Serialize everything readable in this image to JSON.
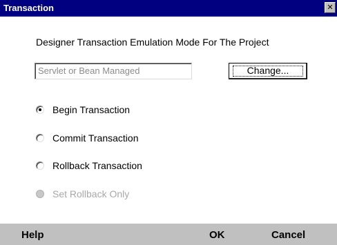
{
  "window": {
    "title": "Transaction",
    "close_glyph": "✕"
  },
  "heading": "Designer Transaction Emulation Mode For The Project",
  "mode_field": {
    "value": "Servlet or Bean Managed"
  },
  "change_button": {
    "label": "Change..."
  },
  "options": [
    {
      "label": "Begin Transaction",
      "checked": true,
      "enabled": true
    },
    {
      "label": "Commit Transaction",
      "checked": false,
      "enabled": true
    },
    {
      "label": "Rollback Transaction",
      "checked": false,
      "enabled": true
    },
    {
      "label": "Set Rollback Only",
      "checked": false,
      "enabled": false
    }
  ],
  "footer": {
    "help_label": "Help",
    "ok_label": "OK",
    "cancel_label": "Cancel"
  },
  "colors": {
    "titlebar": "#000080",
    "footer": "#c0c0c0",
    "disabled_text": "#a8a8a8"
  }
}
